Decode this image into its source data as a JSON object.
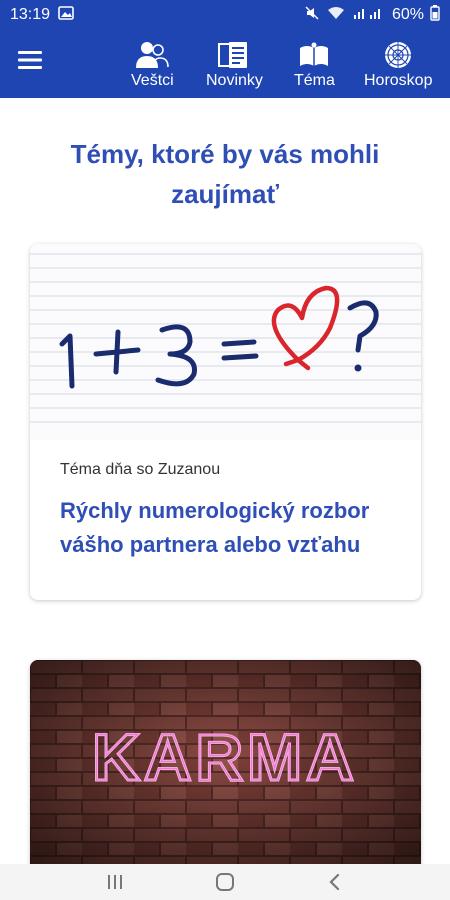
{
  "status_bar": {
    "time": "13:19",
    "battery_percent": "60%",
    "icons": [
      "image-icon",
      "mute-icon",
      "wifi-icon",
      "signal-icon",
      "battery-icon"
    ]
  },
  "app_bar": {
    "menu_icon": "hamburger-menu-icon",
    "nav_items": [
      {
        "label": "Veštci",
        "icon": "people-icon"
      },
      {
        "label": "Novinky",
        "icon": "news-icon"
      },
      {
        "label": "Téma",
        "icon": "book-icon"
      },
      {
        "label": "Horoskop",
        "icon": "zodiac-wheel-icon"
      }
    ]
  },
  "content": {
    "section_title": "Témy, ktoré by vás mohli zaujímať",
    "cards": [
      {
        "image_text": "1 + 3 = ♡ ?",
        "subtitle": "Téma dňa so Zuzanou",
        "title": "Rýchly numerologický rozbor vášho partnera alebo vzťahu"
      },
      {
        "image_text": "KARMA"
      }
    ]
  },
  "colors": {
    "primary": "#1f45b3",
    "title_blue": "#2f4eb6",
    "heart_red": "#d9262c",
    "neon_pink": "#f06bd0"
  },
  "system_nav": {
    "buttons": [
      "recent-apps-icon",
      "home-icon",
      "back-icon"
    ]
  }
}
